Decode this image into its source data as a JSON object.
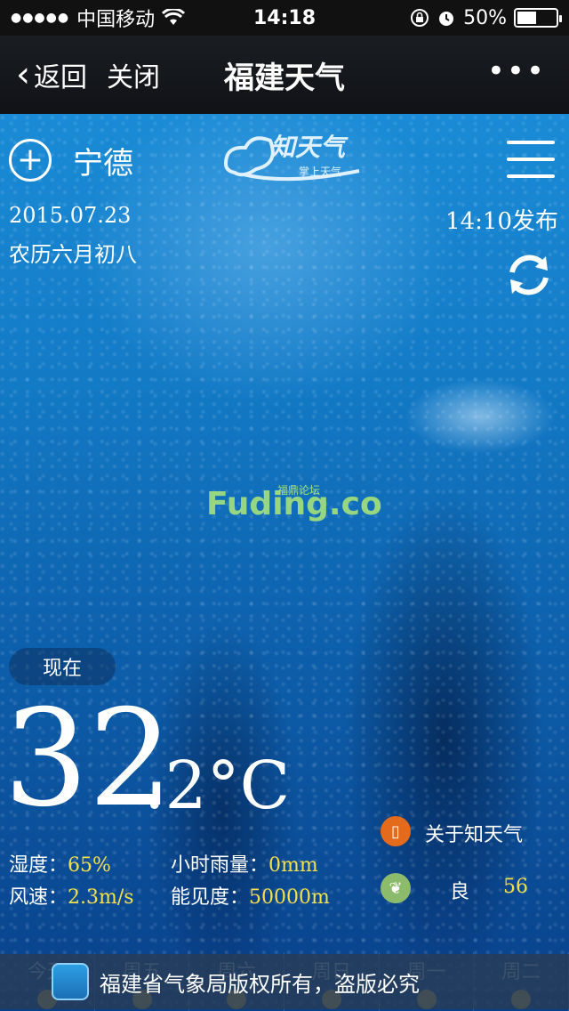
{
  "status_bar": {
    "signal": "●●●●●",
    "carrier": "中国移动",
    "wifi_icon": "wifi-icon",
    "time": "14:18",
    "battery": "50%",
    "battery_level": 0.5
  },
  "nav": {
    "back_label": "返回",
    "close_label": "关闭",
    "title": "福建天气",
    "more": "•••"
  },
  "weather": {
    "city": "宁德",
    "logo_text": "知天气",
    "logo_sub": "掌上天气",
    "date": "2015.07.23",
    "lunar_date": "农历六月初八",
    "publish_time": "14:10发布",
    "now_label": "现在",
    "temp_integer": "32",
    "temp_decimal": ".2°C",
    "humidity_label": "湿度：",
    "humidity_value": "65%",
    "rain_label": "小时雨量：",
    "rain_value": "0mm",
    "wind_label": "风速：",
    "wind_value": "2.3m/s",
    "visibility_label": "能见度：",
    "visibility_value": "50000m",
    "about_label": "关于知天气",
    "air_quality_label": "良",
    "air_quality_value": "56"
  },
  "watermark": {
    "text": "Fuding.co",
    "badge": "福鼎论坛"
  },
  "forecast": {
    "days": [
      "今天",
      "周五",
      "周六",
      "周日",
      "周一",
      "周二"
    ]
  },
  "footer": {
    "text": "福建省气象局版权所有，盗版必究"
  },
  "colors": {
    "value_yellow": "#f5e04a",
    "about_orange": "#e46a1c",
    "air_green": "#8dbb6c"
  }
}
